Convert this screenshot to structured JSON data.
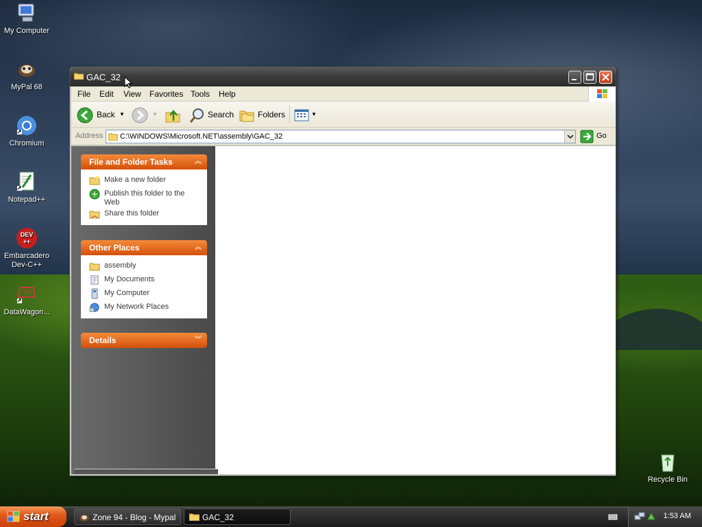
{
  "desktop": {
    "icons": [
      {
        "label": "My Computer",
        "icon": "my-computer-icon"
      },
      {
        "label": "MyPal 68",
        "icon": "mypal-icon"
      },
      {
        "label": "Chromium",
        "icon": "chromium-icon"
      },
      {
        "label": "Notepad++",
        "icon": "notepadpp-icon"
      },
      {
        "label": "Embarcadero Dev-C++",
        "icon": "devcpp-icon"
      },
      {
        "label": "DataWagon...",
        "icon": "datawagon-icon"
      }
    ],
    "recycle_bin": {
      "label": "Recycle Bin",
      "icon": "recycle-bin-icon"
    }
  },
  "window": {
    "title": "GAC_32",
    "menu": [
      "File",
      "Edit",
      "View",
      "Favorites",
      "Tools",
      "Help"
    ],
    "toolbar": {
      "back": "Back",
      "search": "Search",
      "folders": "Folders"
    },
    "address": {
      "label": "Address",
      "value": "C:\\WINDOWS\\Microsoft.NET\\assembly\\GAC_32",
      "go": "Go"
    },
    "panels": {
      "file_folder_tasks": {
        "title": "File and Folder Tasks",
        "items": [
          "Make a new folder",
          "Publish this folder to the Web",
          "Share this folder"
        ]
      },
      "other_places": {
        "title": "Other Places",
        "items": [
          "assembly",
          "My Documents",
          "My Computer",
          "My Network Places"
        ]
      },
      "details": {
        "title": "Details"
      }
    }
  },
  "taskbar": {
    "start": "start",
    "tasks": [
      "Zone 94 - Blog - Mypal",
      "GAC_32"
    ],
    "clock": "1:53 AM"
  },
  "colors": {
    "panel_header": "#e2621a",
    "start_button": "#e25a1a",
    "taskbar": "#2a2a2a"
  }
}
